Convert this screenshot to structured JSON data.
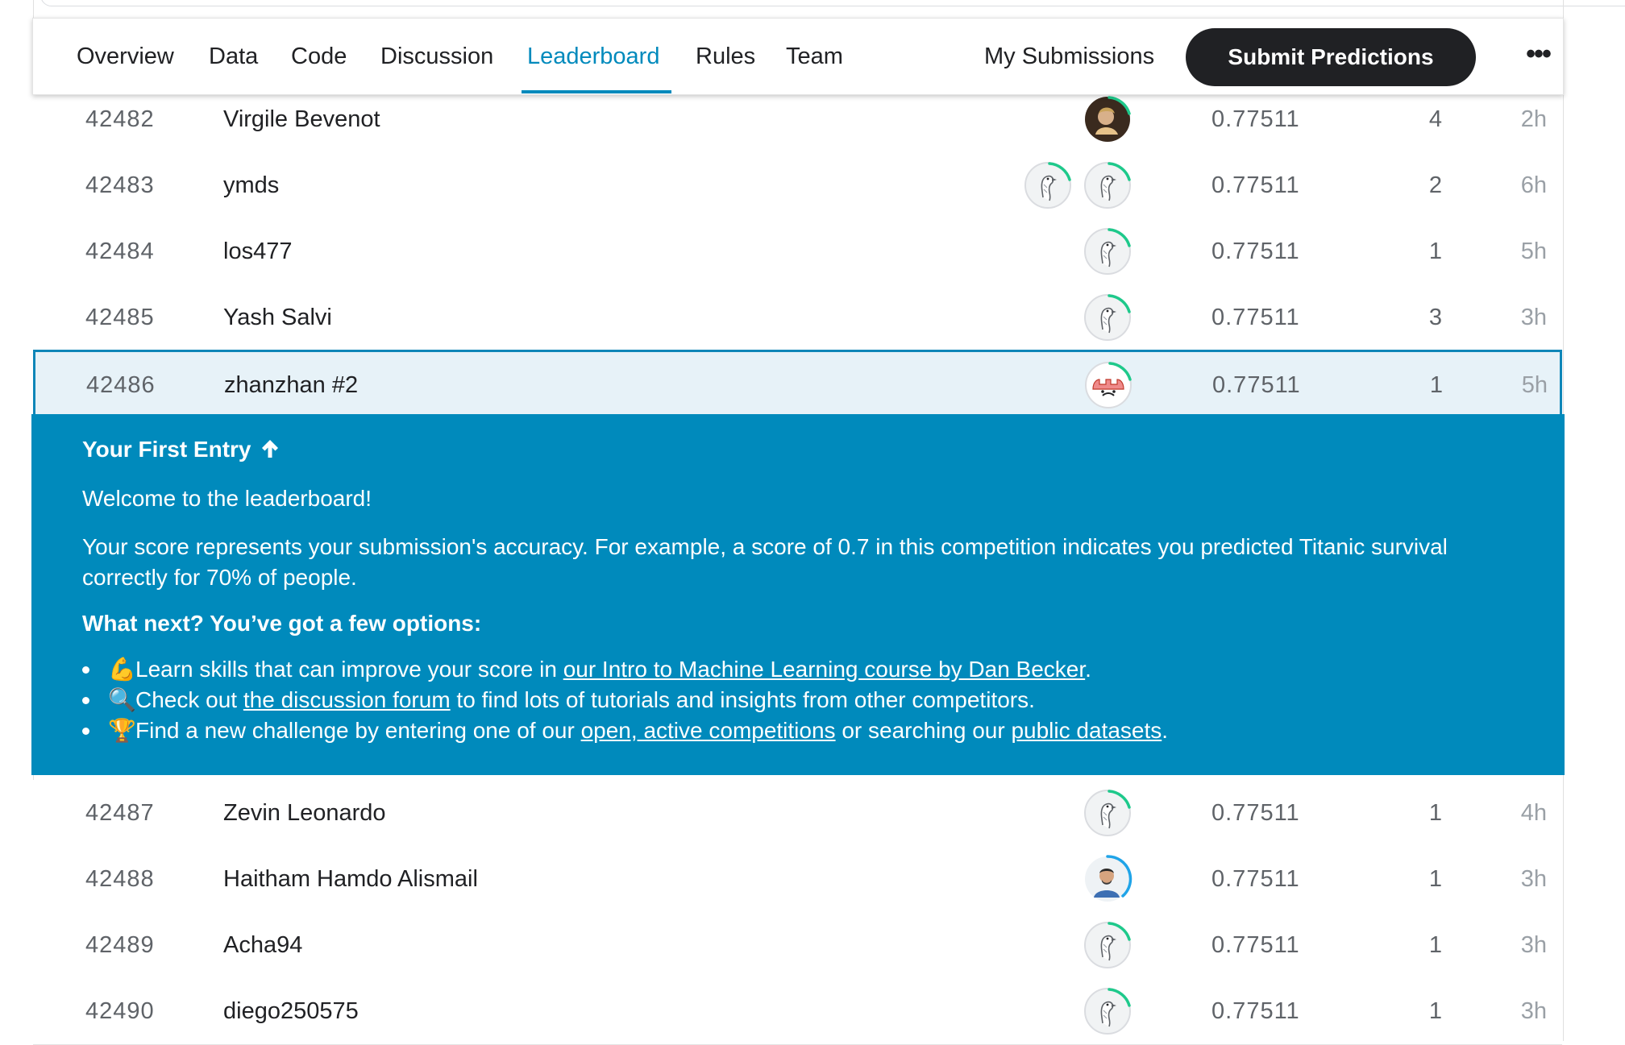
{
  "tabs": [
    {
      "label": "Overview",
      "active": false
    },
    {
      "label": "Data",
      "active": false
    },
    {
      "label": "Code",
      "active": false
    },
    {
      "label": "Discussion",
      "active": false
    },
    {
      "label": "Leaderboard",
      "active": true
    },
    {
      "label": "Rules",
      "active": false
    },
    {
      "label": "Team",
      "active": false
    }
  ],
  "header": {
    "my_submissions": "My Submissions",
    "submit_label": "Submit Predictions",
    "more_label": "•••",
    "active_color": "#008abc"
  },
  "rows": [
    {
      "rank": "42482",
      "name": "Virgile Bevenot",
      "avatars": [
        "photo-portrait"
      ],
      "score": "0.77511",
      "entries": "4",
      "last": "2h"
    },
    {
      "rank": "42483",
      "name": "ymds",
      "avatars": [
        "goose",
        "goose"
      ],
      "score": "0.77511",
      "entries": "2",
      "last": "6h"
    },
    {
      "rank": "42484",
      "name": "los477",
      "avatars": [
        "goose"
      ],
      "score": "0.77511",
      "entries": "1",
      "last": "5h"
    },
    {
      "rank": "42485",
      "name": "Yash Salvi",
      "avatars": [
        "goose"
      ],
      "score": "0.77511",
      "entries": "3",
      "last": "3h"
    },
    {
      "rank": "42486",
      "name": "zhanzhan #2",
      "avatars": [
        "cartoon-face"
      ],
      "score": "0.77511",
      "entries": "1",
      "last": "5h",
      "highlight": true
    },
    {
      "rank": "42487",
      "name": "Zevin Leonardo",
      "avatars": [
        "goose"
      ],
      "score": "0.77511",
      "entries": "1",
      "last": "4h"
    },
    {
      "rank": "42488",
      "name": "Haitham Hamdo Alismail",
      "avatars": [
        "photo-man"
      ],
      "score": "0.77511",
      "entries": "1",
      "last": "3h"
    },
    {
      "rank": "42489",
      "name": "Acha94",
      "avatars": [
        "goose"
      ],
      "score": "0.77511",
      "entries": "1",
      "last": "3h"
    },
    {
      "rank": "42490",
      "name": "diego250575",
      "avatars": [
        "goose"
      ],
      "score": "0.77511",
      "entries": "1",
      "last": "3h"
    }
  ],
  "entry_panel": {
    "title": "Your First Entry",
    "welcome": "Welcome to the leaderboard!",
    "description": "Your score represents your submission's accuracy. For example, a score of 0.7 in this competition indicates you predicted Titanic survival correctly for 70% of people.",
    "next": "What next? You’ve got a few options:",
    "bullets": {
      "b1": {
        "emoji": "💪",
        "pre": "Learn skills that can improve your score in ",
        "link": "our Intro to Machine Learning course by Dan Becker",
        "post": "."
      },
      "b2": {
        "emoji": "🔍",
        "pre": "Check out ",
        "link": "the discussion forum",
        "post": " to find lots of tutorials and insights from other competitors."
      },
      "b3": {
        "emoji": "🏆",
        "pre": "Find a new challenge by entering one of our ",
        "link": "open, active competitions",
        "mid": " or searching our ",
        "link2": "public datasets",
        "post": "."
      }
    },
    "background": "#008abc"
  }
}
